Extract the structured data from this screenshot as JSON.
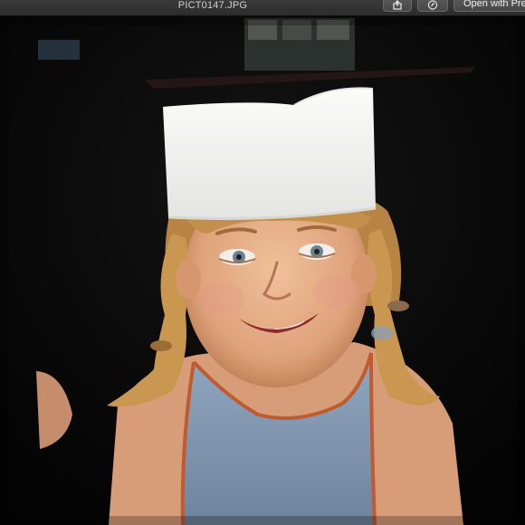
{
  "window": {
    "title": "PICT0147.JPG"
  },
  "toolbar": {
    "share_icon": "share-icon",
    "markup_icon": "markup-pen-icon",
    "open_with_label": "Open with Pre"
  },
  "photo": {
    "subject": "photo",
    "colors": {
      "background": "#070707",
      "hat": "#f3f3f1",
      "hair": "#c99a55",
      "skin": "#e7b58f",
      "shirt": "#7f95ad",
      "trim": "#c0562e"
    }
  }
}
